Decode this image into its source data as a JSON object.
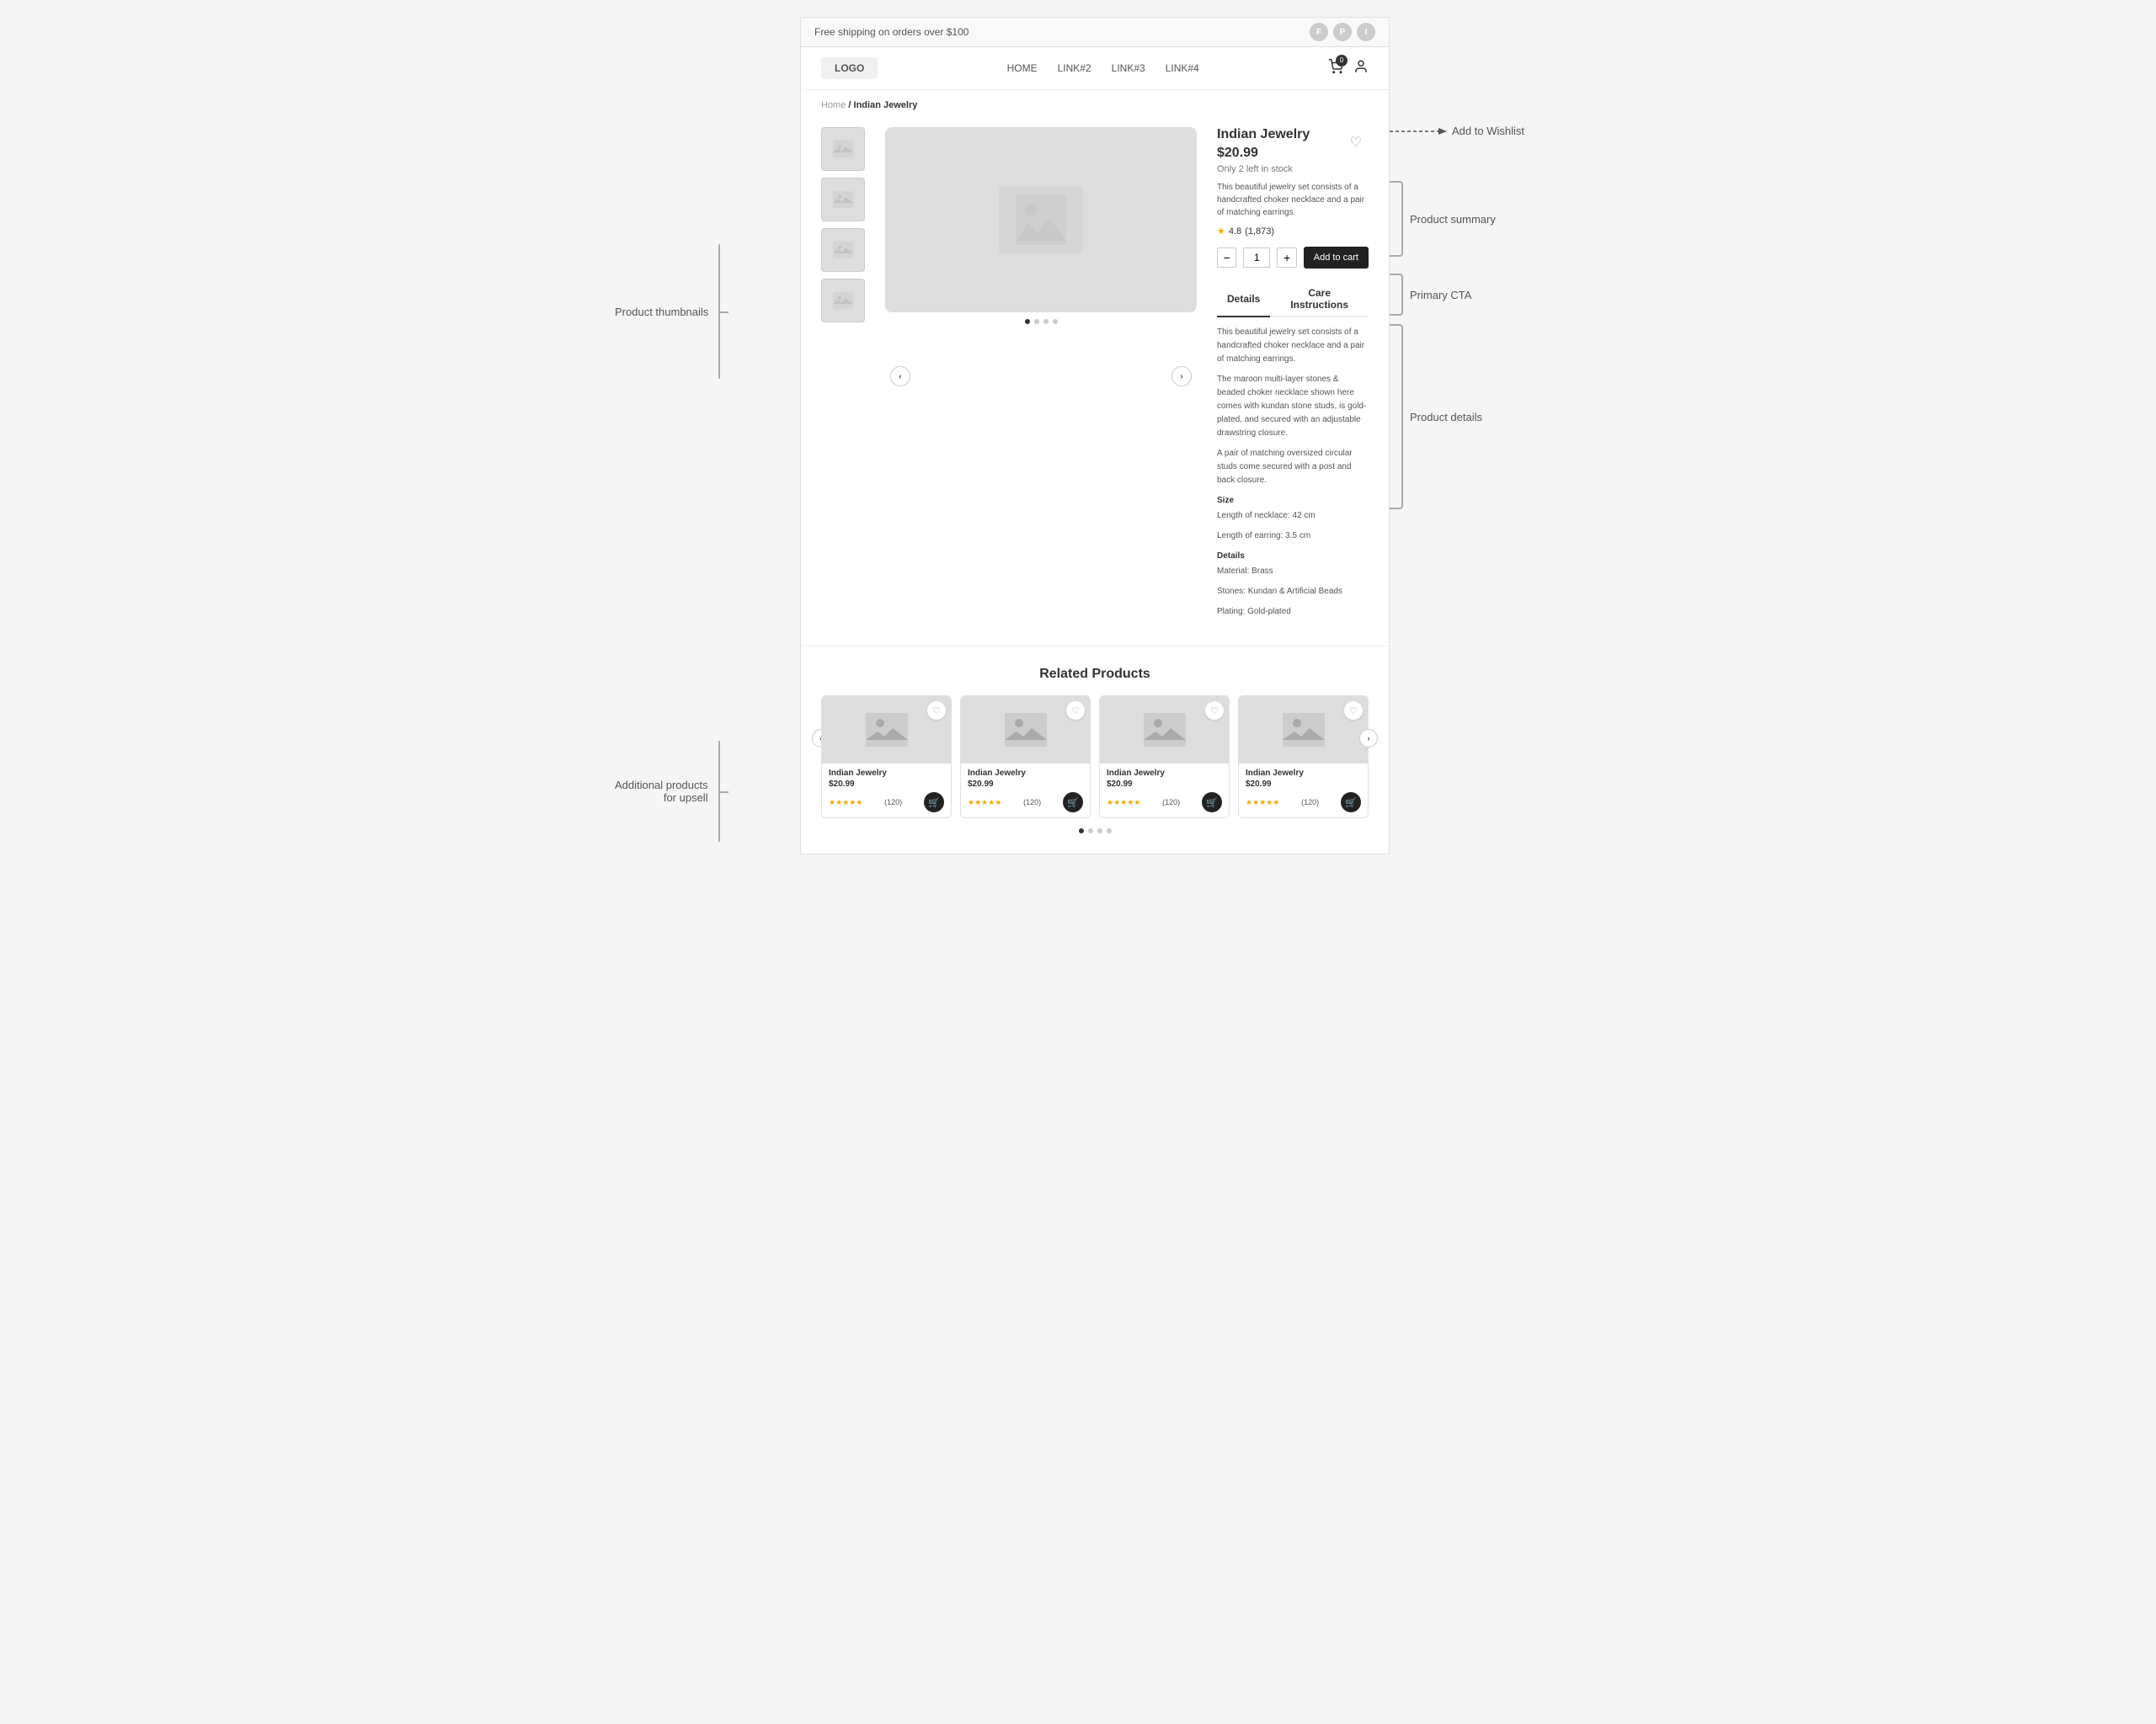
{
  "banner": {
    "text": "Free shipping on orders over $100",
    "social_icons": [
      "F",
      "P",
      "I"
    ]
  },
  "header": {
    "logo": "LOGO",
    "nav_links": [
      "HOME",
      "LINK#2",
      "LINK#3",
      "LINK#4"
    ],
    "cart_count": "0",
    "wishlist_annotation": "Add to Wishlist"
  },
  "breadcrumb": {
    "home": "Home",
    "separator": "/",
    "current": "Indian Jewelry"
  },
  "product": {
    "title": "Indian Jewelry",
    "price": "$20.99",
    "stock": "Only 2 left in stock",
    "description": "This beautiful jewelry set consists of a handcrafted choker necklace and a pair of matching earrings.",
    "rating": "4.8",
    "review_count": "(1,873)",
    "quantity": "1",
    "add_to_cart_label": "Add to cart",
    "tabs": [
      "Details",
      "Care Instructions"
    ],
    "active_tab": "Details",
    "detail_text_1": "This beautiful jewelry set consists of a handcrafted choker necklace and a pair of matching earrings.",
    "detail_text_2": "The maroon multi-layer stones & beaded choker necklace shown here comes with kundan stone studs, is gold-plated, and secured with an adjustable drawstring closure.",
    "detail_text_3": "A pair of matching oversized circular studs come secured with a post and back closure.",
    "size_label": "Size",
    "necklace_length": "Length of necklace: 42 cm",
    "earring_length": "Length of earring: 3.5 cm",
    "details_label": "Details",
    "material": "Material: Brass",
    "stones": "Stones: Kundan & Artificial Beads",
    "plating": "Plating: Gold-plated"
  },
  "related": {
    "title": "Related Products",
    "products": [
      {
        "name": "Indian Jewelry",
        "price": "$20.99",
        "rating": "★★★★★",
        "count": "(120)"
      },
      {
        "name": "Indian Jewelry",
        "price": "$20.99",
        "rating": "★★★★★",
        "count": "(120)"
      },
      {
        "name": "Indian Jewelry",
        "price": "$20.99",
        "rating": "★★★★★",
        "count": "(120)"
      },
      {
        "name": "Indian Jewelry",
        "price": "$20.99",
        "rating": "★★★★★",
        "count": "(120)"
      }
    ]
  },
  "annotations": {
    "left": {
      "thumbnails_label": "Product thumbnails",
      "upsell_label": "Additional products\nfor upsell"
    },
    "right": {
      "summary_label": "Product summary",
      "cta_label": "Primary CTA",
      "details_label": "Product details"
    }
  },
  "dots": {
    "active": 0,
    "total": 4
  }
}
